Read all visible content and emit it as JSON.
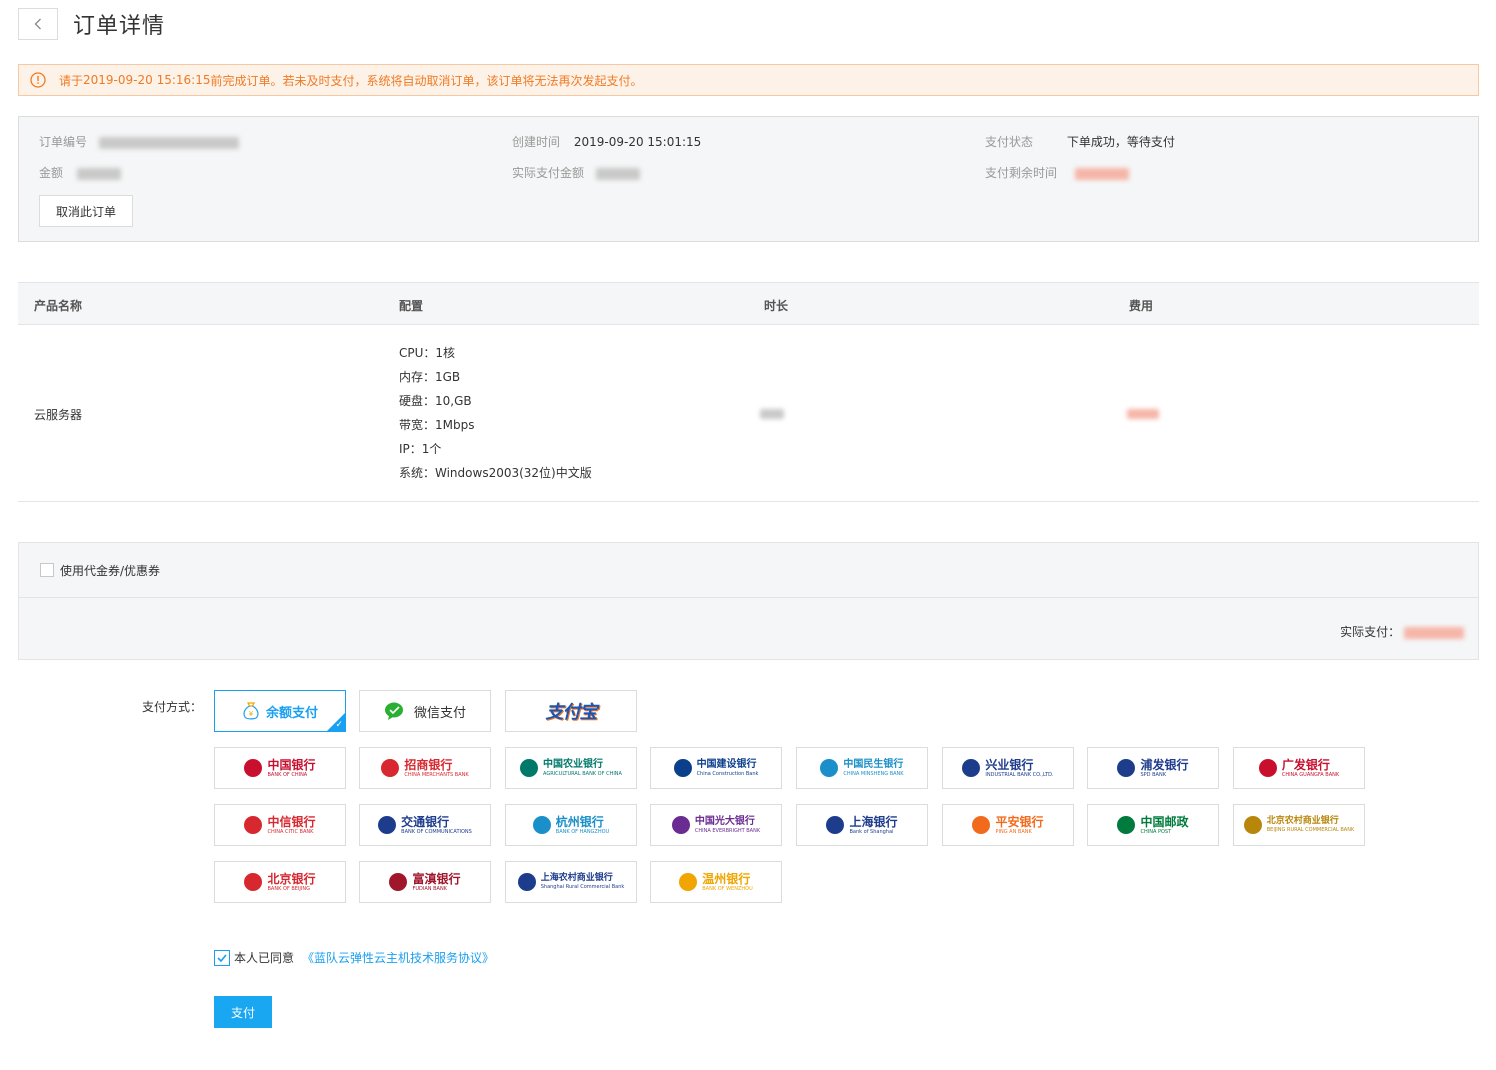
{
  "header": {
    "title": "订单详情"
  },
  "alert": {
    "prefix": "请于 ",
    "deadline": "2019-09-20 15:16:15",
    "suffix": " 前完成订单。若未及时支付，系统将自动取消订单，该订单将无法再次发起支付。"
  },
  "order": {
    "order_no_label": "订单编号",
    "amount_label": "金额",
    "created_label": "创建时间",
    "created_value": "2019-09-20 15:01:15",
    "actual_amount_label": "实际支付金额",
    "status_label": "支付状态",
    "status_value": "下单成功，等待支付",
    "remaining_label": "支付剩余时间",
    "cancel_button": "取消此订单"
  },
  "table": {
    "headers": [
      "产品名称",
      "配置",
      "时长",
      "费用"
    ],
    "row": {
      "product": "云服务器",
      "config": [
        "CPU：1核",
        "内存：1GB",
        "硬盘：10,GB",
        "带宽：1Mbps",
        "IP：1个",
        "系统：Windows2003(32位)中文版"
      ]
    }
  },
  "coupon": {
    "label": "使用代金券/优惠券",
    "actual_pay_label": "实际支付："
  },
  "payment": {
    "label": "支付方式：",
    "options": [
      "余额支付",
      "微信支付",
      "支付宝"
    ],
    "banks": [
      {
        "cn": "中国银行",
        "en": "BANK OF CHINA",
        "color": "#c8102e"
      },
      {
        "cn": "招商银行",
        "en": "CHINA MERCHANTS BANK",
        "color": "#d7282f"
      },
      {
        "cn": "中国农业银行",
        "en": "AGRICULTURAL BANK OF CHINA",
        "color": "#00796b"
      },
      {
        "cn": "中国建设银行",
        "en": "China Construction Bank",
        "color": "#0b3f8b"
      },
      {
        "cn": "中国民生银行",
        "en": "CHINA MINSHENG BANK",
        "color": "#1a8fc9"
      },
      {
        "cn": "兴业银行",
        "en": "INDUSTRIAL BANK CO.,LTD.",
        "color": "#1e3c8c"
      },
      {
        "cn": "浦发银行",
        "en": "SPD BANK",
        "color": "#1e3c8c"
      },
      {
        "cn": "广发银行",
        "en": "CHINA GUANGFA BANK",
        "color": "#c8102e"
      },
      {
        "cn": "中信银行",
        "en": "CHINA CITIC BANK",
        "color": "#d7282f"
      },
      {
        "cn": "交通银行",
        "en": "BANK OF COMMUNICATIONS",
        "color": "#1e3c8c"
      },
      {
        "cn": "杭州银行",
        "en": "BANK OF HANGZHOU",
        "color": "#1a8fc9"
      },
      {
        "cn": "中国光大银行",
        "en": "CHINA EVERBRIGHT BANK",
        "color": "#6a2c91"
      },
      {
        "cn": "上海银行",
        "en": "Bank of Shanghai",
        "color": "#1e3c8c"
      },
      {
        "cn": "平安银行",
        "en": "PING AN BANK",
        "color": "#f26b1d"
      },
      {
        "cn": "中国邮政",
        "en": "CHINA POST",
        "color": "#007a3d"
      },
      {
        "cn": "北京农村商业银行",
        "en": "BEIJING RURAL COMMERCIAL BANK",
        "color": "#b8860b"
      },
      {
        "cn": "北京银行",
        "en": "BANK OF BEIJING",
        "color": "#d7282f"
      },
      {
        "cn": "富滇银行",
        "en": "FUDIAN BANK",
        "color": "#a0162b"
      },
      {
        "cn": "上海农村商业银行",
        "en": "Shanghai Rural Commercial Bank",
        "color": "#1e3c8c"
      },
      {
        "cn": "温州银行",
        "en": "BANK OF WENZHOU",
        "color": "#f0a500"
      }
    ]
  },
  "agreement": {
    "prefix": "本人已同意",
    "link": "《蓝队云弹性云主机技术服务协议》"
  },
  "submit": {
    "label": "支付"
  },
  "colors": {
    "accent": "#1aa0f0",
    "warning": "#f07a24"
  }
}
